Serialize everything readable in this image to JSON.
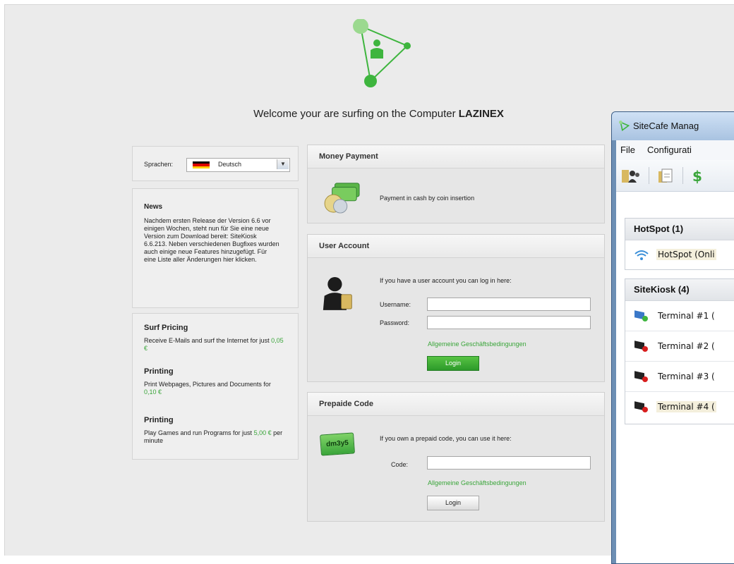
{
  "welcome": {
    "prefix": "Welcome your are surfing on the Computer",
    "computer": "LAZINEX"
  },
  "language": {
    "label": "Sprachen:",
    "selected": "Deutsch"
  },
  "news": {
    "title": "News",
    "body": "Nachdem ersten Release der Version 6.6 vor einigen Wochen, steht nun für Sie eine neue Version zum Download bereit: SiteKiosk 6.6.213. Neben verschiedenen Bugfixes wurden auch einige neue Features hinzugefügt. Für eine Liste aller Änderungen hier klicken."
  },
  "pricing": {
    "title": "Surf Pricing",
    "surf_text": "Receive E-Mails and surf the Internet for just",
    "surf_price": "0,05 €",
    "printing_title": "Printing",
    "printing_text": "Print Webpages, Pictures and Documents for",
    "printing_price": "0,10 €",
    "games_title": "Printing",
    "games_text": "Play Games and run Programs for just",
    "games_price": "5,00 €",
    "games_suffix": "per minute"
  },
  "money": {
    "title": "Money Payment",
    "text": "Payment in cash by coin insertion"
  },
  "account": {
    "title": "User Account",
    "intro": "If you have a user account you can log in here:",
    "username_label": "Username:",
    "password_label": "Password:",
    "terms": "Allgemeine Geschäftsbedingungen",
    "login": "Login"
  },
  "prepaid": {
    "title": "Prepaide Code",
    "intro": "If you own a prepaid code, you can use it here:",
    "code_label": "Code:",
    "terms": "Allgemeine Geschäftsbedingungen",
    "login": "Login",
    "card_text": "dm3y5"
  },
  "manager": {
    "title": "SiteCafe Manag",
    "menu": [
      "File",
      "Configurati"
    ],
    "hotspot_group": "HotSpot (1)",
    "hotspot_item": "HotSpot (Onli",
    "sitekiosk_group": "SiteKiosk (4)",
    "terminals": [
      "Terminal #1 (",
      "Terminal #2 (",
      "Terminal #3 (",
      "Terminal #4 ("
    ]
  },
  "colors": {
    "accent_green": "#3aa53a",
    "flag": [
      "#000000",
      "#dd0000",
      "#ffce00"
    ]
  },
  "icons": [
    "sitecafe-logo-icon",
    "coins-icon",
    "user-icon",
    "prepaid-card-icon",
    "wifi-icon",
    "terminal-online-icon",
    "terminal-offline-icon",
    "users-icon",
    "document-icon",
    "money-icon"
  ]
}
